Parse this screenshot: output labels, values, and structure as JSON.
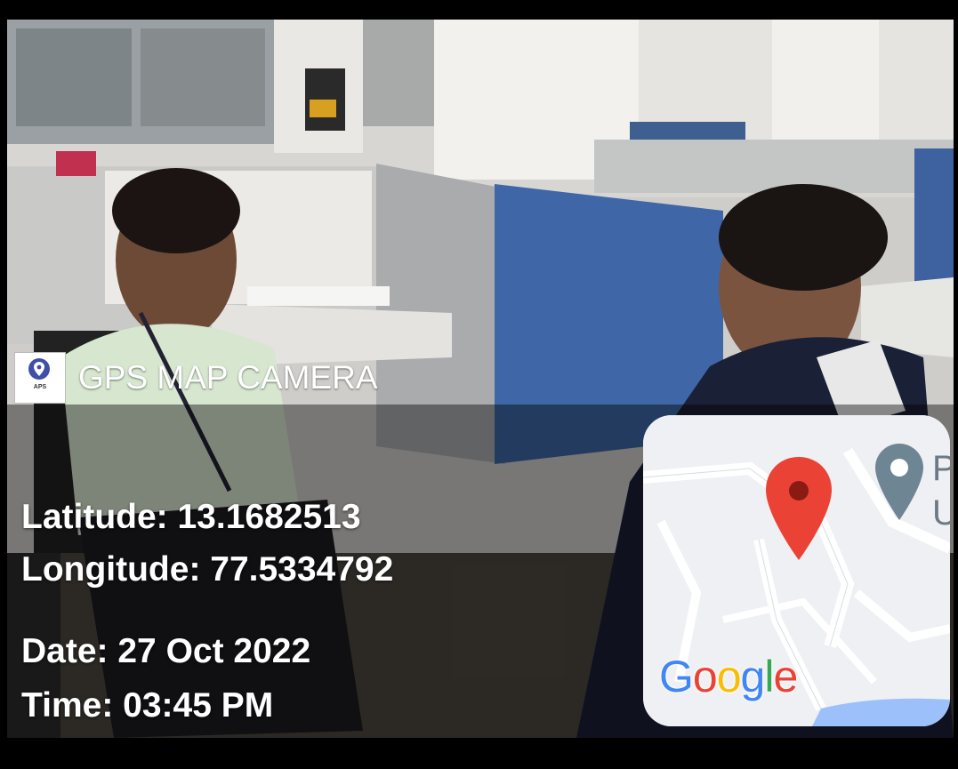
{
  "camera": {
    "app_name": "GPS MAP CAMERA",
    "logo_text": "APS"
  },
  "location": {
    "latitude_label": "Latitude: 13.1682513",
    "longitude_label": "Longitude: 77.5334792"
  },
  "capture": {
    "date_label": "Date: 27 Oct 2022",
    "time_label": "Time: 03:45 PM"
  },
  "map": {
    "attribution_letters": [
      "G",
      "o",
      "o",
      "g",
      "l",
      "e"
    ],
    "attribution_colors": [
      "#4285F4",
      "#EA4335",
      "#FBBC05",
      "#4285F4",
      "#34A853",
      "#EA4335"
    ],
    "place_label_line1": "P",
    "place_label_line2": "U",
    "marker_color": "#EA4335",
    "place_marker_color": "#6e8594"
  },
  "icons": {
    "brand": "location-pin-icon",
    "marker": "map-marker-icon",
    "place": "place-pin-icon"
  }
}
